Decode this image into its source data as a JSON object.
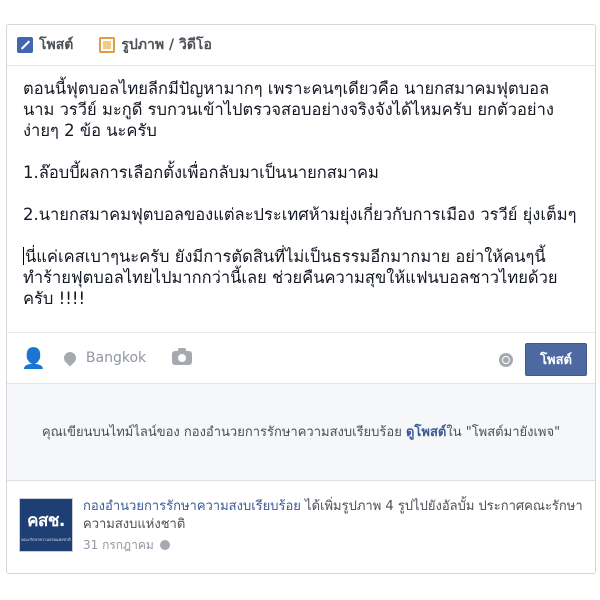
{
  "composer": {
    "tabs": [
      {
        "label": "โพสต์",
        "icon": "pencil-icon"
      },
      {
        "label": "รูปภาพ / วิดีโอ",
        "icon": "photo-icon"
      }
    ],
    "text": {
      "p1": "ตอนนี้ฟุตบอลไทยลีกมีปัญหามากๆ เพราะคนๆเดียวคือ นายกสมาคมฟุตบอล นาม วรวีย์ มะกูดี รบกวนเข้าไปตรวจสอบอย่างจริงจังได้ไหมครับ ยกตัวอย่างง่ายๆ 2 ข้อ นะครับ",
      "p2": "1.ล๊อบบี้ผลการเลือกตั้งเพื่อกลับมาเป็นนายกสมาคม",
      "p3": "2.นายกสมาคมฟุตบอลของแต่ละประเทศห้ามยุ่งเกี่ยวกับการเมือง วรวีย์ ยุ่งเต็มๆ",
      "p4": "นี่แค่เคสเบาๆนะครับ ยังมีการตัดสินที่ไม่เป็นธรรมอีกมากมาย อย่าให้คนๆนี้ทำร้ายฟุตบอลไทยไปมากกว่านี้เลย ช่วยคืนความสุขให้แฟนบอลชาวไทยด้วยครับ !!!!"
    },
    "location": "Bangkok",
    "post_button": "โพสต์",
    "icons": {
      "tag": "tag-people-icon",
      "location": "location-pin-icon",
      "camera": "camera-icon",
      "privacy": "globe-icon"
    }
  },
  "notice": {
    "prefix": "คุณเขียนบนไทม์ไลน์ของ กองอำนวยการรักษาความสงบเรียบร้อย ",
    "link": "ดูโพสต์",
    "suffix": "ใน \"โพสต์มายังเพจ\""
  },
  "story": {
    "avatar_text": "คสช.",
    "avatar_subtext": "คณะรักษาความสงบแห่งชาติ",
    "actor": "กองอำนวยการรักษาความสงบเรียบร้อย",
    "action": " ได้เพิ่มรูปภาพ 4 รูปไปยังอัลบั้ม ประกาศคณะรักษาความสงบแห่งชาติ",
    "date": "31 กรกฎาคม"
  },
  "colors": {
    "link": "#3b5998",
    "button": "#4e69a2",
    "border": "#d3d6db"
  }
}
